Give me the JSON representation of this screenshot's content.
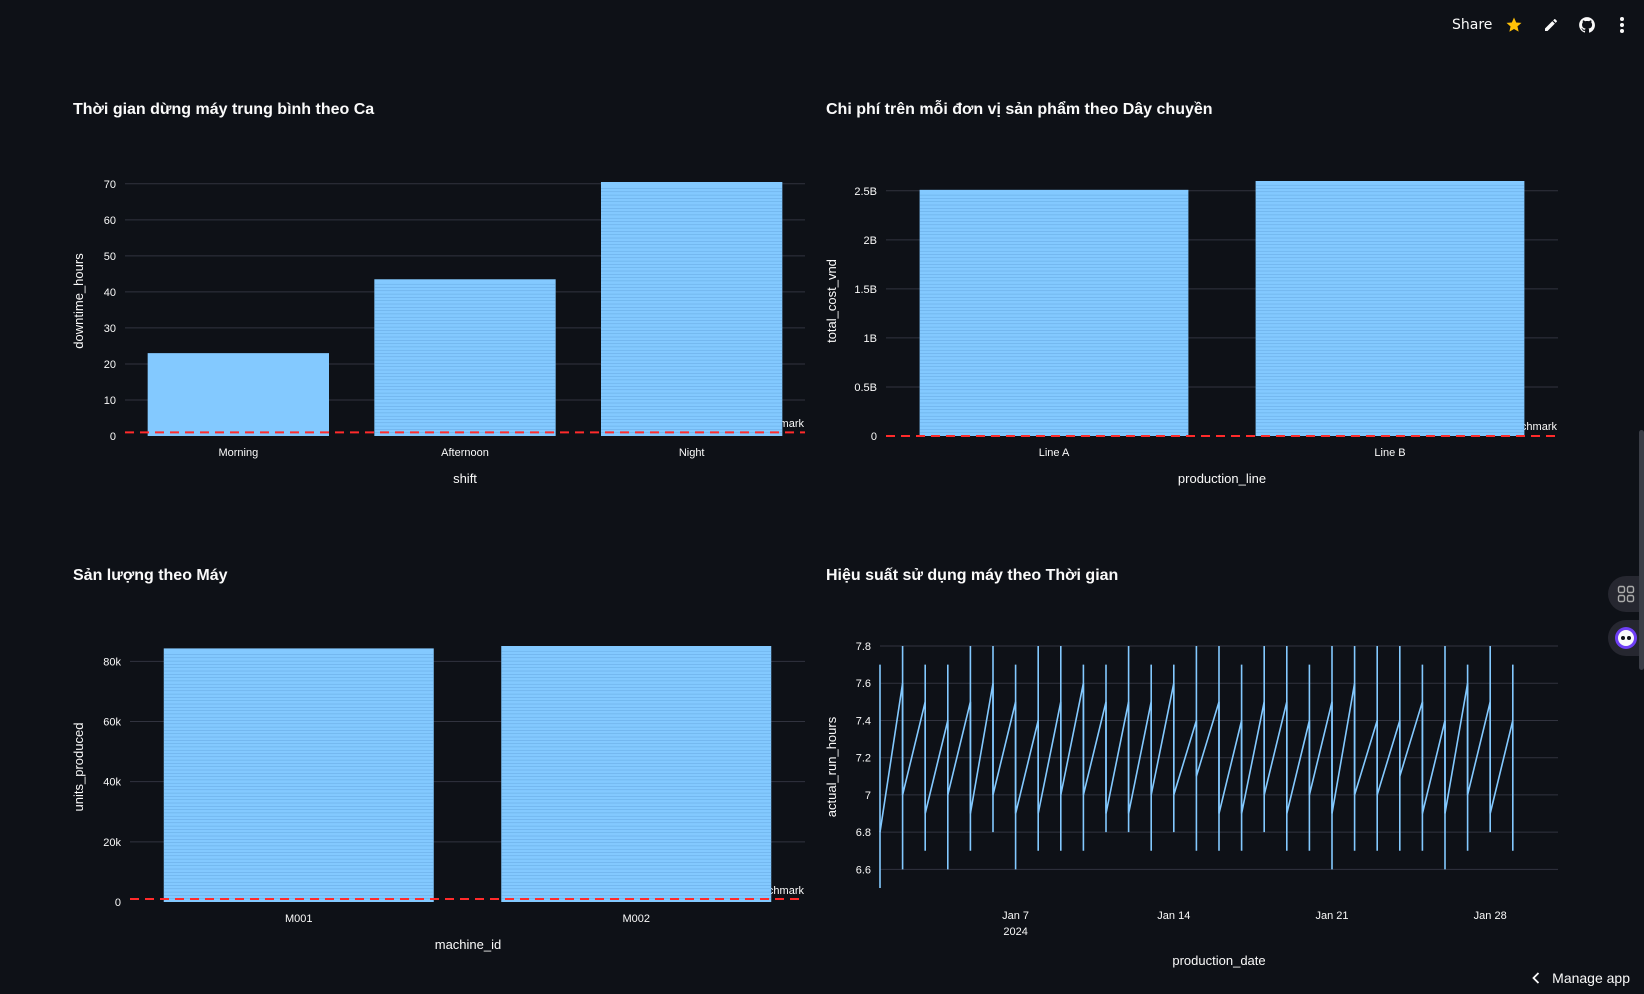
{
  "header": {
    "share_label": "Share"
  },
  "icons": [
    "star-icon",
    "pencil-icon",
    "github-icon",
    "more-vertical-icon",
    "chevron-left-icon"
  ],
  "colors": {
    "background": "#0e1117",
    "bar": "#83c9ff",
    "benchmark": "#ff2b2b",
    "star": "#ffc107"
  },
  "benchmark_label": "Benchmark",
  "footer": {
    "manage_label": "Manage app"
  },
  "chart_data": [
    {
      "type": "bar",
      "title": "Thời gian dừng máy trung bình theo Ca",
      "xlabel": "shift",
      "ylabel": "downtime_hours",
      "categories": [
        "Morning",
        "Afternoon",
        "Night"
      ],
      "values": [
        23,
        43.5,
        70.5
      ],
      "ylim": [
        0,
        70.5
      ],
      "yticks": [
        0,
        10,
        20,
        30,
        40,
        50,
        60,
        70
      ],
      "ytick_labels": [
        "0",
        "10",
        "20",
        "30",
        "40",
        "50",
        "60",
        "70"
      ],
      "benchmark": 1,
      "grid": true
    },
    {
      "type": "bar",
      "title": "Chi phí trên mỗi đơn vị sản phẩm theo Dây chuyền",
      "xlabel": "production_line",
      "ylabel": "total_cost_vnd",
      "categories": [
        "Line A",
        "Line B"
      ],
      "values": [
        2510000000,
        2600000000
      ],
      "ylim": [
        0,
        2600000000
      ],
      "yticks": [
        0,
        500000000,
        1000000000,
        1500000000,
        2000000000,
        2500000000
      ],
      "ytick_labels": [
        "0",
        "0.5B",
        "1B",
        "1.5B",
        "2B",
        "2.5B"
      ],
      "benchmark": 0,
      "grid": true
    },
    {
      "type": "bar",
      "title": "Sản lượng theo Máy",
      "xlabel": "machine_id",
      "ylabel": "units_produced",
      "categories": [
        "M001",
        "M002"
      ],
      "values": [
        84300,
        85100
      ],
      "ylim": [
        0,
        85100
      ],
      "yticks": [
        0,
        20000,
        40000,
        60000,
        80000
      ],
      "ytick_labels": [
        "0",
        "20k",
        "40k",
        "60k",
        "80k"
      ],
      "benchmark": 1000,
      "grid": true
    },
    {
      "type": "line",
      "title": "Hiệu suất sử dụng máy theo Thời gian",
      "xlabel": "production_date",
      "ylabel": "actual_run_hours",
      "x_range": [
        "2024-01-01",
        "2024-01-31"
      ],
      "xticks": [
        "2024-01-07",
        "2024-01-14",
        "2024-01-21",
        "2024-01-28"
      ],
      "xtick_labels": [
        "Jan 7",
        "Jan 14",
        "Jan 21",
        "Jan 28"
      ],
      "xtick_sublabel": "2024",
      "ylim": [
        6.5,
        7.8
      ],
      "yticks": [
        6.6,
        6.8,
        7,
        7.2,
        7.4,
        7.6,
        7.8
      ],
      "ytick_labels": [
        "6.6",
        "6.8",
        "7",
        "7.2",
        "7.4",
        "7.6",
        "7.8"
      ],
      "grid": true,
      "series": [
        {
          "days": [
            {
              "date": "2024-01-01",
              "low": 6.5,
              "high": 7.7
            },
            {
              "date": "2024-01-02",
              "low": 6.6,
              "high": 7.8
            },
            {
              "date": "2024-01-03",
              "low": 6.7,
              "high": 7.7
            },
            {
              "date": "2024-01-04",
              "low": 6.6,
              "high": 7.7
            },
            {
              "date": "2024-01-05",
              "low": 6.7,
              "high": 7.8
            },
            {
              "date": "2024-01-06",
              "low": 6.8,
              "high": 7.8
            },
            {
              "date": "2024-01-07",
              "low": 6.6,
              "high": 7.7
            },
            {
              "date": "2024-01-08",
              "low": 6.7,
              "high": 7.8
            },
            {
              "date": "2024-01-09",
              "low": 6.7,
              "high": 7.8
            },
            {
              "date": "2024-01-10",
              "low": 6.7,
              "high": 7.7
            },
            {
              "date": "2024-01-11",
              "low": 6.8,
              "high": 7.7
            },
            {
              "date": "2024-01-12",
              "low": 6.8,
              "high": 7.8
            },
            {
              "date": "2024-01-13",
              "low": 6.7,
              "high": 7.7
            },
            {
              "date": "2024-01-14",
              "low": 6.8,
              "high": 7.7
            },
            {
              "date": "2024-01-15",
              "low": 6.7,
              "high": 7.8
            },
            {
              "date": "2024-01-16",
              "low": 6.7,
              "high": 7.8
            },
            {
              "date": "2024-01-17",
              "low": 6.7,
              "high": 7.7
            },
            {
              "date": "2024-01-18",
              "low": 6.8,
              "high": 7.8
            },
            {
              "date": "2024-01-19",
              "low": 6.7,
              "high": 7.8
            },
            {
              "date": "2024-01-20",
              "low": 6.7,
              "high": 7.7
            },
            {
              "date": "2024-01-21",
              "low": 6.6,
              "high": 7.8
            },
            {
              "date": "2024-01-22",
              "low": 6.7,
              "high": 7.8
            },
            {
              "date": "2024-01-23",
              "low": 6.7,
              "high": 7.8
            },
            {
              "date": "2024-01-24",
              "low": 6.7,
              "high": 7.8
            },
            {
              "date": "2024-01-25",
              "low": 6.7,
              "high": 7.7
            },
            {
              "date": "2024-01-26",
              "low": 6.6,
              "high": 7.8
            },
            {
              "date": "2024-01-27",
              "low": 6.7,
              "high": 7.7
            },
            {
              "date": "2024-01-28",
              "low": 6.8,
              "high": 7.8
            },
            {
              "date": "2024-01-29",
              "low": 6.7,
              "high": 7.7
            }
          ],
          "trace": [
            [
              "2024-01-01",
              6.8
            ],
            [
              "2024-01-02",
              7.6
            ],
            [
              "2024-01-02",
              7.0
            ],
            [
              "2024-01-03",
              7.5
            ],
            [
              "2024-01-03",
              6.9
            ],
            [
              "2024-01-04",
              7.4
            ],
            [
              "2024-01-04",
              7.0
            ],
            [
              "2024-01-05",
              7.5
            ],
            [
              "2024-01-05",
              6.9
            ],
            [
              "2024-01-06",
              7.6
            ],
            [
              "2024-01-06",
              7.0
            ],
            [
              "2024-01-07",
              7.5
            ],
            [
              "2024-01-07",
              6.9
            ],
            [
              "2024-01-08",
              7.4
            ],
            [
              "2024-01-08",
              6.9
            ],
            [
              "2024-01-09",
              7.5
            ],
            [
              "2024-01-09",
              7.0
            ],
            [
              "2024-01-10",
              7.6
            ],
            [
              "2024-01-10",
              7.0
            ],
            [
              "2024-01-11",
              7.5
            ],
            [
              "2024-01-11",
              6.9
            ],
            [
              "2024-01-12",
              7.5
            ],
            [
              "2024-01-12",
              6.9
            ],
            [
              "2024-01-13",
              7.5
            ],
            [
              "2024-01-13",
              7.0
            ],
            [
              "2024-01-14",
              7.6
            ],
            [
              "2024-01-14",
              7.0
            ],
            [
              "2024-01-15",
              7.4
            ],
            [
              "2024-01-15",
              7.1
            ],
            [
              "2024-01-16",
              7.5
            ],
            [
              "2024-01-16",
              6.9
            ],
            [
              "2024-01-17",
              7.4
            ],
            [
              "2024-01-17",
              6.9
            ],
            [
              "2024-01-18",
              7.5
            ],
            [
              "2024-01-18",
              7.0
            ],
            [
              "2024-01-19",
              7.5
            ],
            [
              "2024-01-19",
              6.9
            ],
            [
              "2024-01-20",
              7.4
            ],
            [
              "2024-01-20",
              7.0
            ],
            [
              "2024-01-21",
              7.5
            ],
            [
              "2024-01-21",
              6.9
            ],
            [
              "2024-01-22",
              7.6
            ],
            [
              "2024-01-22",
              7.0
            ],
            [
              "2024-01-23",
              7.4
            ],
            [
              "2024-01-23",
              7.0
            ],
            [
              "2024-01-24",
              7.4
            ],
            [
              "2024-01-24",
              7.1
            ],
            [
              "2024-01-25",
              7.5
            ],
            [
              "2024-01-25",
              6.9
            ],
            [
              "2024-01-26",
              7.4
            ],
            [
              "2024-01-26",
              6.9
            ],
            [
              "2024-01-27",
              7.6
            ],
            [
              "2024-01-27",
              7.0
            ],
            [
              "2024-01-28",
              7.5
            ],
            [
              "2024-01-28",
              6.9
            ],
            [
              "2024-01-29",
              7.4
            ],
            [
              "2024-01-29",
              7.4
            ]
          ]
        }
      ]
    }
  ]
}
